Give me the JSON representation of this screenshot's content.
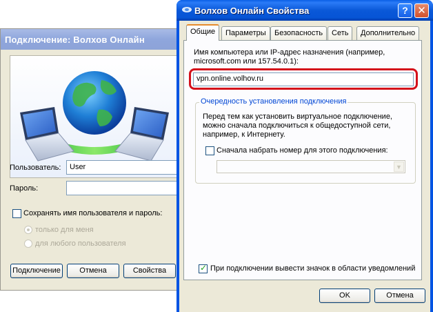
{
  "connect_dialog": {
    "title": "Подключение: Волхов Онлайн",
    "user_label": "Пользователь:",
    "user_value": "User",
    "password_label": "Пароль:",
    "password_value": "",
    "save_credentials_label": "Сохранять имя пользователя и пароль:",
    "radio_me_only": "только для меня",
    "radio_any_user": "для любого пользователя",
    "buttons": {
      "connect": "Подключение",
      "cancel": "Отмена",
      "properties": "Свойства"
    }
  },
  "properties_dialog": {
    "title": "Волхов Онлайн Свойства",
    "help_glyph": "?",
    "close_glyph": "✕",
    "tabs": [
      {
        "label": "Общие",
        "active": true
      },
      {
        "label": "Параметры",
        "active": false
      },
      {
        "label": "Безопасность",
        "active": false
      },
      {
        "label": "Сеть",
        "active": false
      },
      {
        "label": "Дополнительно",
        "active": false
      }
    ],
    "host_label_line1": "Имя компьютера или IP-адрес назначения (например,",
    "host_label_line2": "microsoft.com или 157.54.0.1):",
    "host_value": "vpn.online.volhov.ru",
    "group_title": "Очередность установления подключения",
    "group_text_line1": "Перед тем как установить виртуальное подключение,",
    "group_text_line2": "можно сначала подключиться к общедоступной сети,",
    "group_text_line3": "например, к Интернету.",
    "dial_first_label": "Сначала набрать номер для этого подключения:",
    "dial_first_combo_value": "",
    "show_icon_label": "При подключении вывести значок в области уведомлений",
    "buttons": {
      "ok": "OK",
      "cancel": "Отмена"
    }
  },
  "colors": {
    "highlight": "#d4101a",
    "xp_title_blue": "#0054e3",
    "group_title": "#0046d5"
  }
}
